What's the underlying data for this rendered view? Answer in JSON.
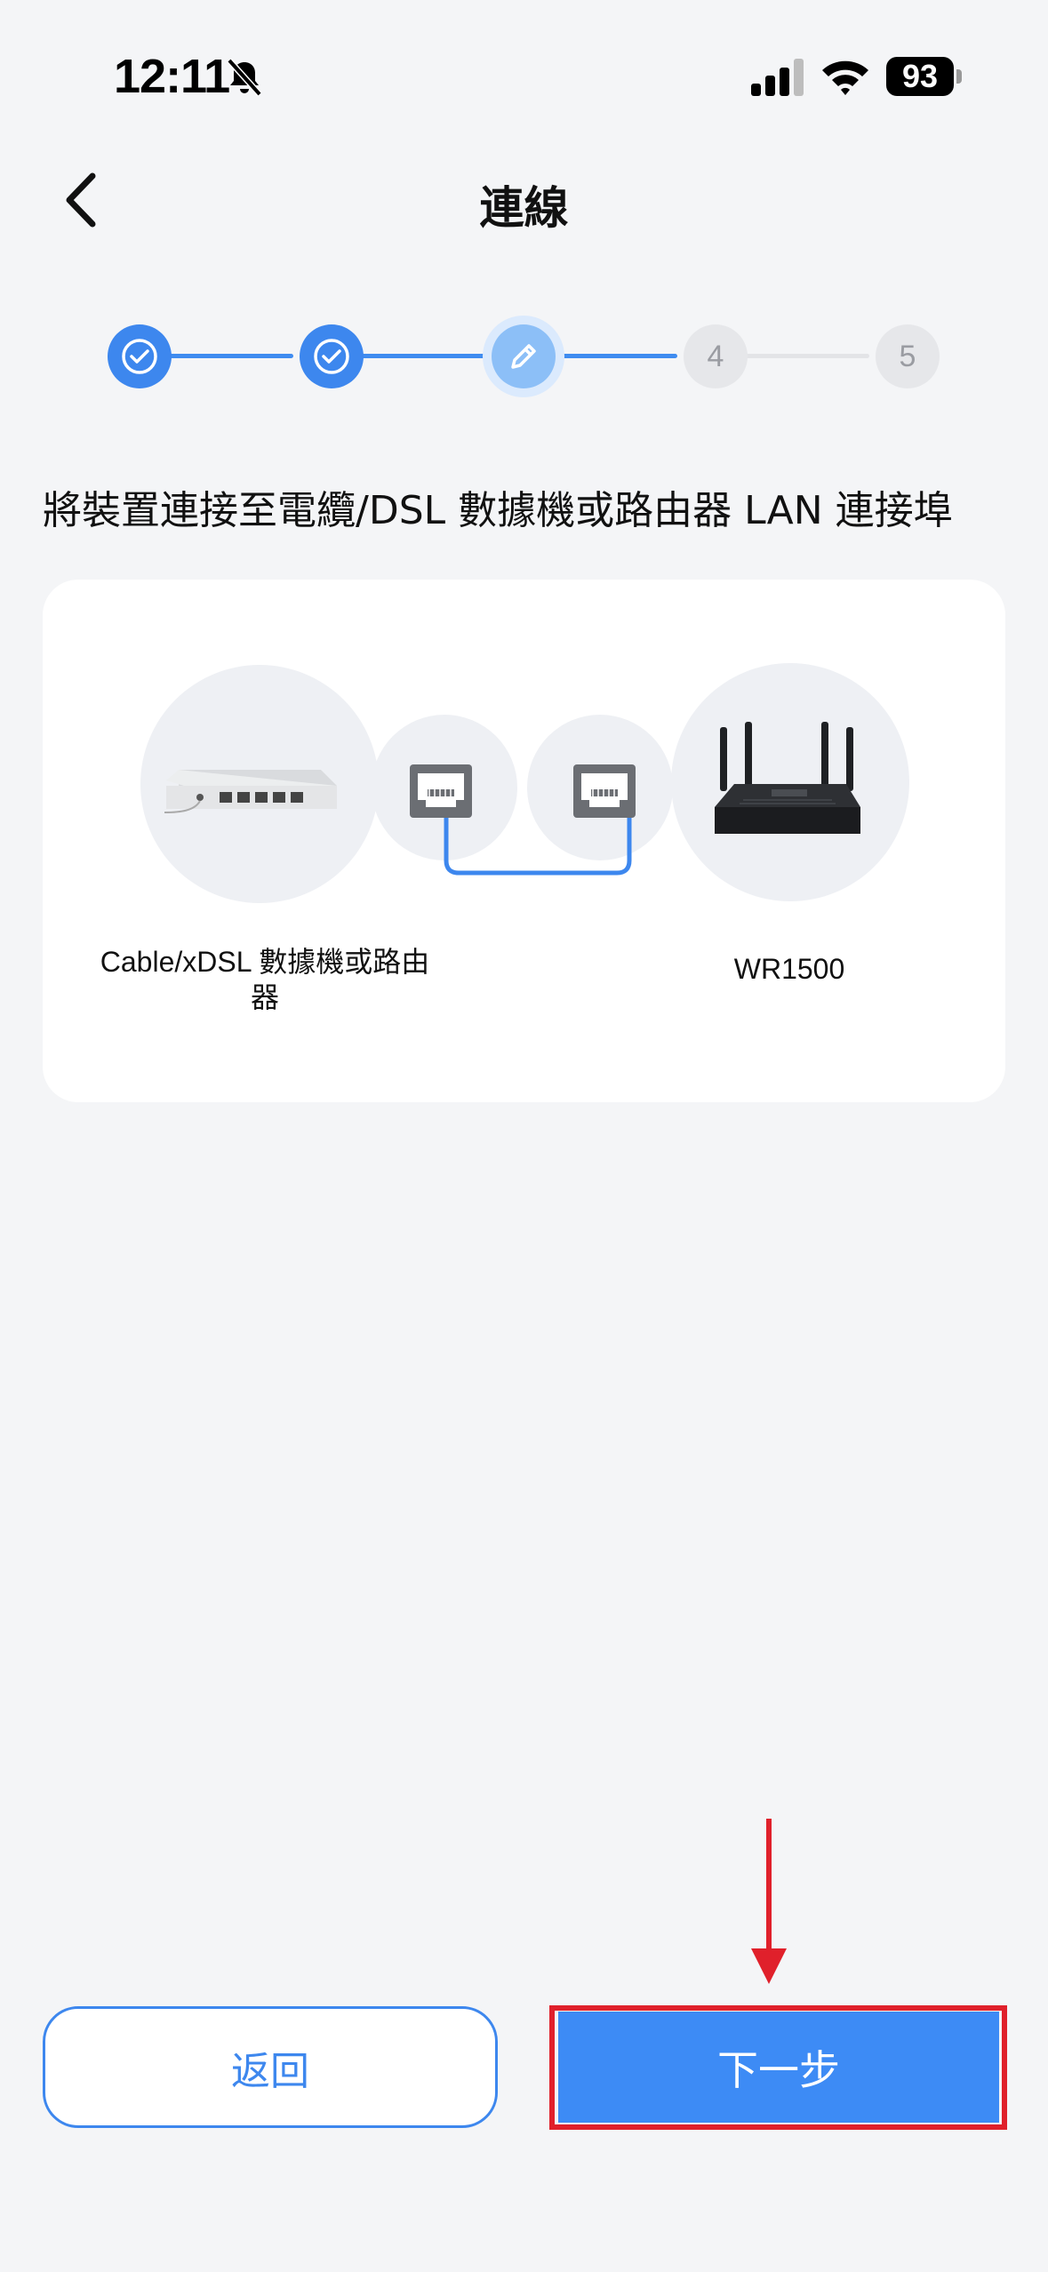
{
  "status_bar": {
    "time": "12:11",
    "battery": "93"
  },
  "header": {
    "title": "連線"
  },
  "stepper": {
    "steps": [
      {
        "state": "done",
        "label": ""
      },
      {
        "state": "done",
        "label": ""
      },
      {
        "state": "current",
        "label": ""
      },
      {
        "state": "todo",
        "label": "4"
      },
      {
        "state": "todo",
        "label": "5"
      }
    ]
  },
  "instruction": "將裝置連接至電纜/DSL 數據機或路由器 LAN 連接埠",
  "diagram": {
    "left_device_label": "Cable/xDSL 數據機或路由器",
    "right_device_label": "WR1500"
  },
  "buttons": {
    "back": "返回",
    "next": "下一步"
  },
  "colors": {
    "accent": "#3d87ee",
    "highlight": "#e0202b",
    "background": "#f4f5f7"
  }
}
